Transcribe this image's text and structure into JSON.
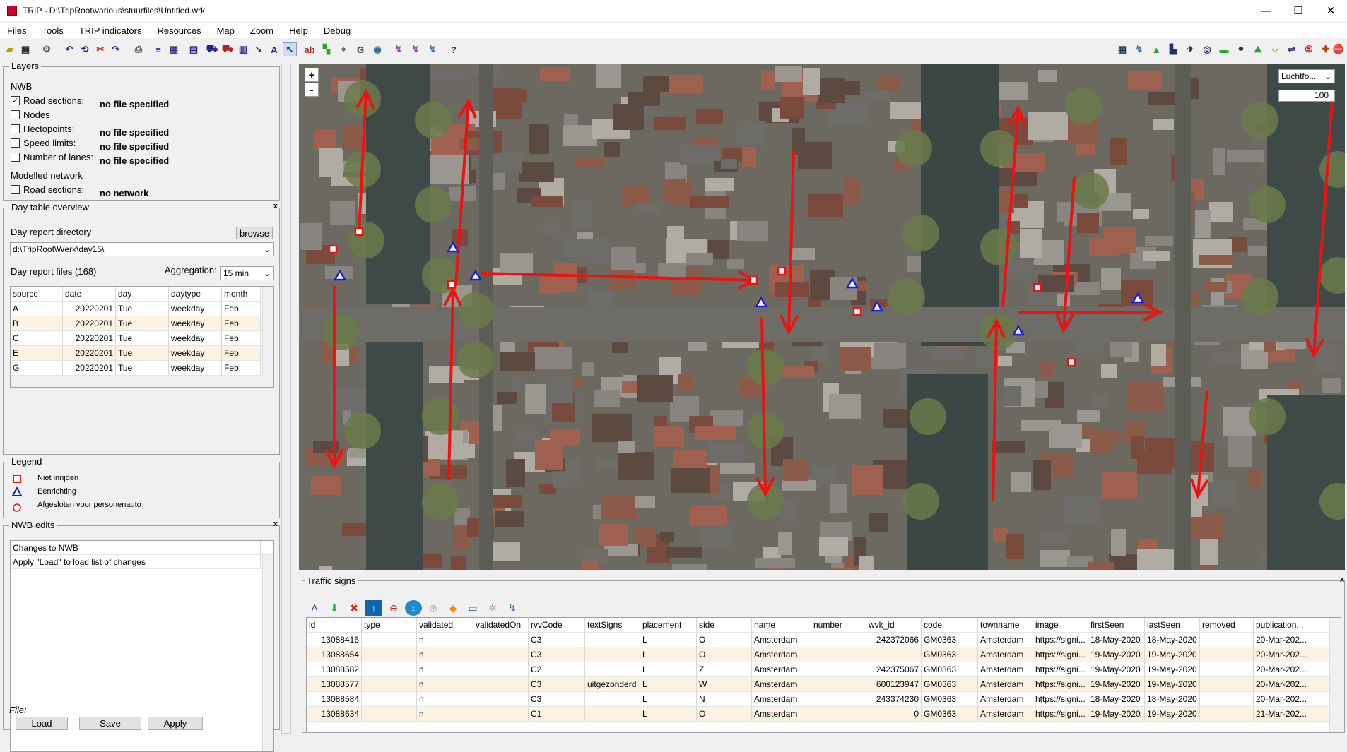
{
  "window": {
    "title": "TRIP - D:\\TripRoot\\various\\stuurfiles\\Untitled.wrk",
    "minimize": "—",
    "maximize": "☐",
    "close": "✕"
  },
  "menu": [
    "Files",
    "Tools",
    "TRIP indicators",
    "Resources",
    "Map",
    "Zoom",
    "Help",
    "Debug"
  ],
  "layers": {
    "title": "Layers",
    "nwb_header": "NWB",
    "items": [
      {
        "label": "Road sections:",
        "checked": true,
        "value": "no file specified"
      },
      {
        "label": "Nodes",
        "checked": false,
        "value": ""
      },
      {
        "label": "Hectopoints:",
        "checked": false,
        "value": "no file specified"
      },
      {
        "label": "Speed limits:",
        "checked": false,
        "value": "no file specified"
      },
      {
        "label": "Number of lanes:",
        "checked": false,
        "value": "no file specified"
      }
    ],
    "modelled_header": "Modelled network",
    "modelled_item": {
      "label": "Road sections:",
      "checked": false,
      "value": "no network"
    }
  },
  "day_table": {
    "title": "Day table overview",
    "close": "x",
    "dir_label": "Day report directory",
    "browse": "browse",
    "dir_value": "d:\\TripRoot\\Werk\\day15\\",
    "files_label": "Day report files (168)",
    "aggregation_label": "Aggregation:",
    "aggregation_value": "15 min",
    "columns": [
      "source",
      "date",
      "day",
      "daytype",
      "month"
    ],
    "rows": [
      [
        "A",
        "20220201",
        "Tue",
        "weekday",
        "Feb"
      ],
      [
        "B",
        "20220201",
        "Tue",
        "weekday",
        "Feb"
      ],
      [
        "C",
        "20220201",
        "Tue",
        "weekday",
        "Feb"
      ],
      [
        "E",
        "20220201",
        "Tue",
        "weekday",
        "Feb"
      ],
      [
        "G",
        "20220201",
        "Tue",
        "weekday",
        "Feb"
      ]
    ]
  },
  "legend": {
    "title": "Legend",
    "items": [
      {
        "label": "Niet inrijden",
        "color": "#ee1111"
      },
      {
        "label": "Eenrichting",
        "color": "#1111ee"
      },
      {
        "label": "Afgesloten voor personenauto",
        "color": "#ee1111"
      }
    ]
  },
  "nwb_edits": {
    "title": "NWB edits",
    "close": "x",
    "list_header": "Changes to NWB",
    "list_row": "Apply \"Load\" to load list of changes",
    "file_label": "File:",
    "load": "Load",
    "save": "Save",
    "apply": "Apply"
  },
  "map": {
    "zoom_in": "+",
    "zoom_out": "-",
    "layer_select": "Luchtfo...",
    "opacity": "100",
    "arrow_color": "#ee1111",
    "triangle_color": "#1a1ae0"
  },
  "traffic_signs": {
    "title": "Traffic signs",
    "close": "x",
    "columns": [
      "id",
      "type",
      "validated",
      "validatedOn",
      "rvvCode",
      "textSigns",
      "placement",
      "side",
      "name",
      "number",
      "wvk_id",
      "code",
      "townname",
      "image",
      "firstSeen",
      "lastSeen",
      "removed",
      "publication..."
    ],
    "rows": [
      [
        "13088416",
        "",
        "n",
        "",
        "C3",
        "",
        "L",
        "O",
        "Amsterdam",
        "",
        "242372066",
        "GM0363",
        "Amsterdam",
        "https://signi...",
        "18-May-2020",
        "18-May-2020",
        "",
        "20-Mar-202..."
      ],
      [
        "13088654",
        "",
        "n",
        "",
        "C3",
        "",
        "L",
        "O",
        "Amsterdam",
        "",
        "",
        "GM0363",
        "Amsterdam",
        "https://signi...",
        "19-May-2020",
        "19-May-2020",
        "",
        "20-Mar-202..."
      ],
      [
        "13088582",
        "",
        "n",
        "",
        "C2",
        "",
        "L",
        "Z",
        "Amsterdam",
        "",
        "242375067",
        "GM0363",
        "Amsterdam",
        "https://signi...",
        "19-May-2020",
        "19-May-2020",
        "",
        "20-Mar-202..."
      ],
      [
        "13088577",
        "",
        "n",
        "",
        "C3",
        "uitgezonderd",
        "L",
        "W",
        "Amsterdam",
        "",
        "600123947",
        "GM0363",
        "Amsterdam",
        "https://signi...",
        "19-May-2020",
        "19-May-2020",
        "",
        "20-Mar-202..."
      ],
      [
        "13088584",
        "",
        "n",
        "",
        "C3",
        "",
        "L",
        "N",
        "Amsterdam",
        "",
        "243374230",
        "GM0363",
        "Amsterdam",
        "https://signi...",
        "18-May-2020",
        "18-May-2020",
        "",
        "20-Mar-202..."
      ],
      [
        "13088634",
        "",
        "n",
        "",
        "C1",
        "",
        "L",
        "O",
        "Amsterdam",
        "",
        "0",
        "GM0363",
        "Amsterdam",
        "https://signi...",
        "19-May-2020",
        "19-May-2020",
        "",
        "21-Mar-202..."
      ]
    ]
  }
}
